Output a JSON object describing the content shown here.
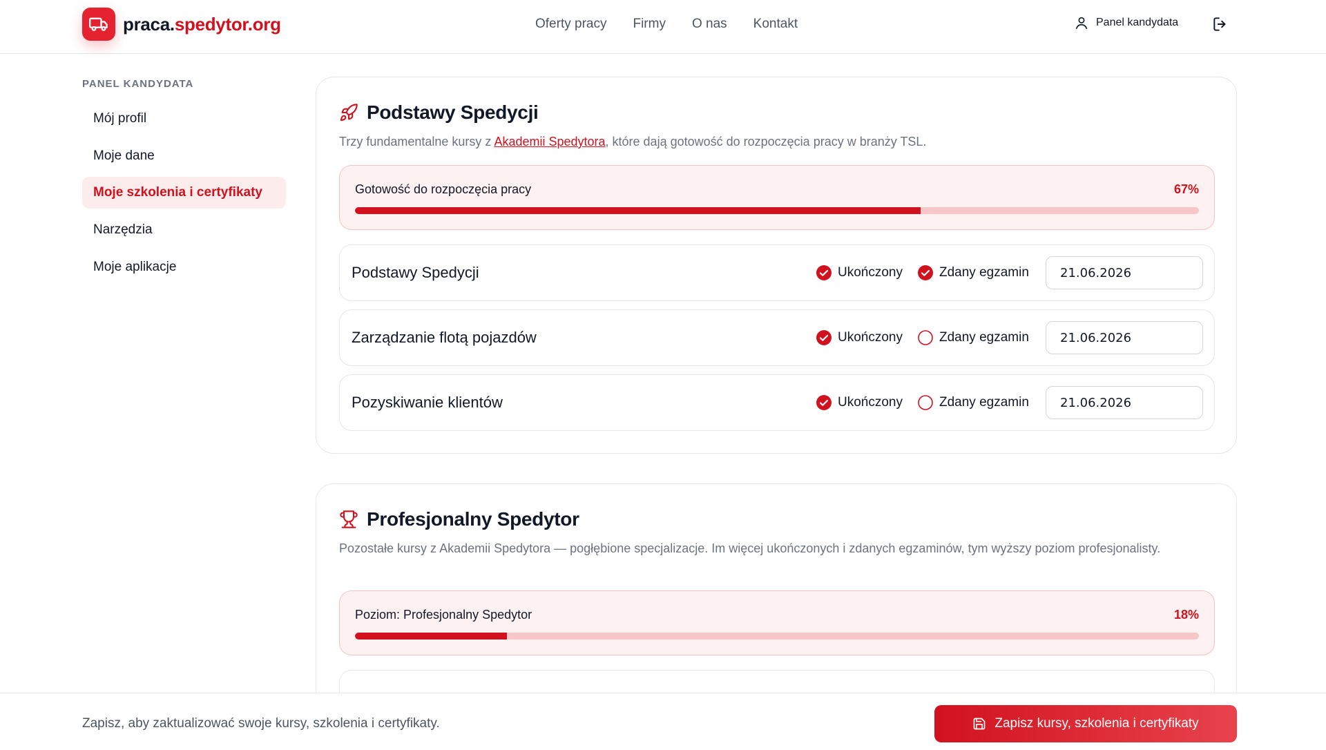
{
  "brand": {
    "prefix": "praca.",
    "name": "spedytor.org"
  },
  "nav": [
    {
      "label": "Oferty pracy"
    },
    {
      "label": "Firmy"
    },
    {
      "label": "O nas"
    },
    {
      "label": "Kontakt"
    }
  ],
  "header": {
    "panel_label": "Panel kandydata"
  },
  "sidebar": {
    "title": "PANEL KANDYDATA",
    "items": [
      {
        "label": "Mój profil",
        "active": false
      },
      {
        "label": "Moje dane",
        "active": false
      },
      {
        "label": "Moje szkolenia i certyfikaty",
        "active": true
      },
      {
        "label": "Narzędzia",
        "active": false
      },
      {
        "label": "Moje aplikacje",
        "active": false
      }
    ]
  },
  "sections": [
    {
      "icon": "rocket-icon",
      "title": "Podstawy Spedycji",
      "desc_before": "Trzy fundamentalne kursy z ",
      "desc_link": "Akademii Spedytora",
      "desc_after": ", które dają gotowość do rozpoczęcia pracy w branży TSL.",
      "progress": {
        "label": "Gotowość do rozpoczęcia pracy",
        "pct": "67%",
        "value": 67
      },
      "courses": [
        {
          "name": "Podstawy Spedycji",
          "completed_label": "Ukończony",
          "completed": true,
          "exam_label": "Zdany egzamin",
          "exam": true,
          "date": "21.06.2026"
        },
        {
          "name": "Zarządzanie flotą pojazdów",
          "completed_label": "Ukończony",
          "completed": true,
          "exam_label": "Zdany egzamin",
          "exam": false,
          "date": "21.06.2026"
        },
        {
          "name": "Pozyskiwanie klientów",
          "completed_label": "Ukończony",
          "completed": true,
          "exam_label": "Zdany egzamin",
          "exam": false,
          "date": "21.06.2026"
        }
      ]
    },
    {
      "icon": "trophy-icon",
      "title": "Profesjonalny Spedytor",
      "desc": "Pozostałe kursy z Akademii Spedytora — pogłębione specjalizacje. Im więcej ukończonych i zdanych egzaminów, tym wyższy poziom profesjonalisty.",
      "progress": {
        "label": "Poziom: Profesjonalny Spedytor",
        "pct": "18%",
        "value": 18
      }
    }
  ],
  "bottom": {
    "text": "Zapisz, aby zaktualizować swoje kursy, szkolenia i certyfikaty.",
    "save_label": "Zapisz kursy, szkolenia i certyfikaty"
  },
  "colors": {
    "accent": "#d1121e",
    "accent_light": "#fdecec",
    "track": "#f6c6c9"
  }
}
